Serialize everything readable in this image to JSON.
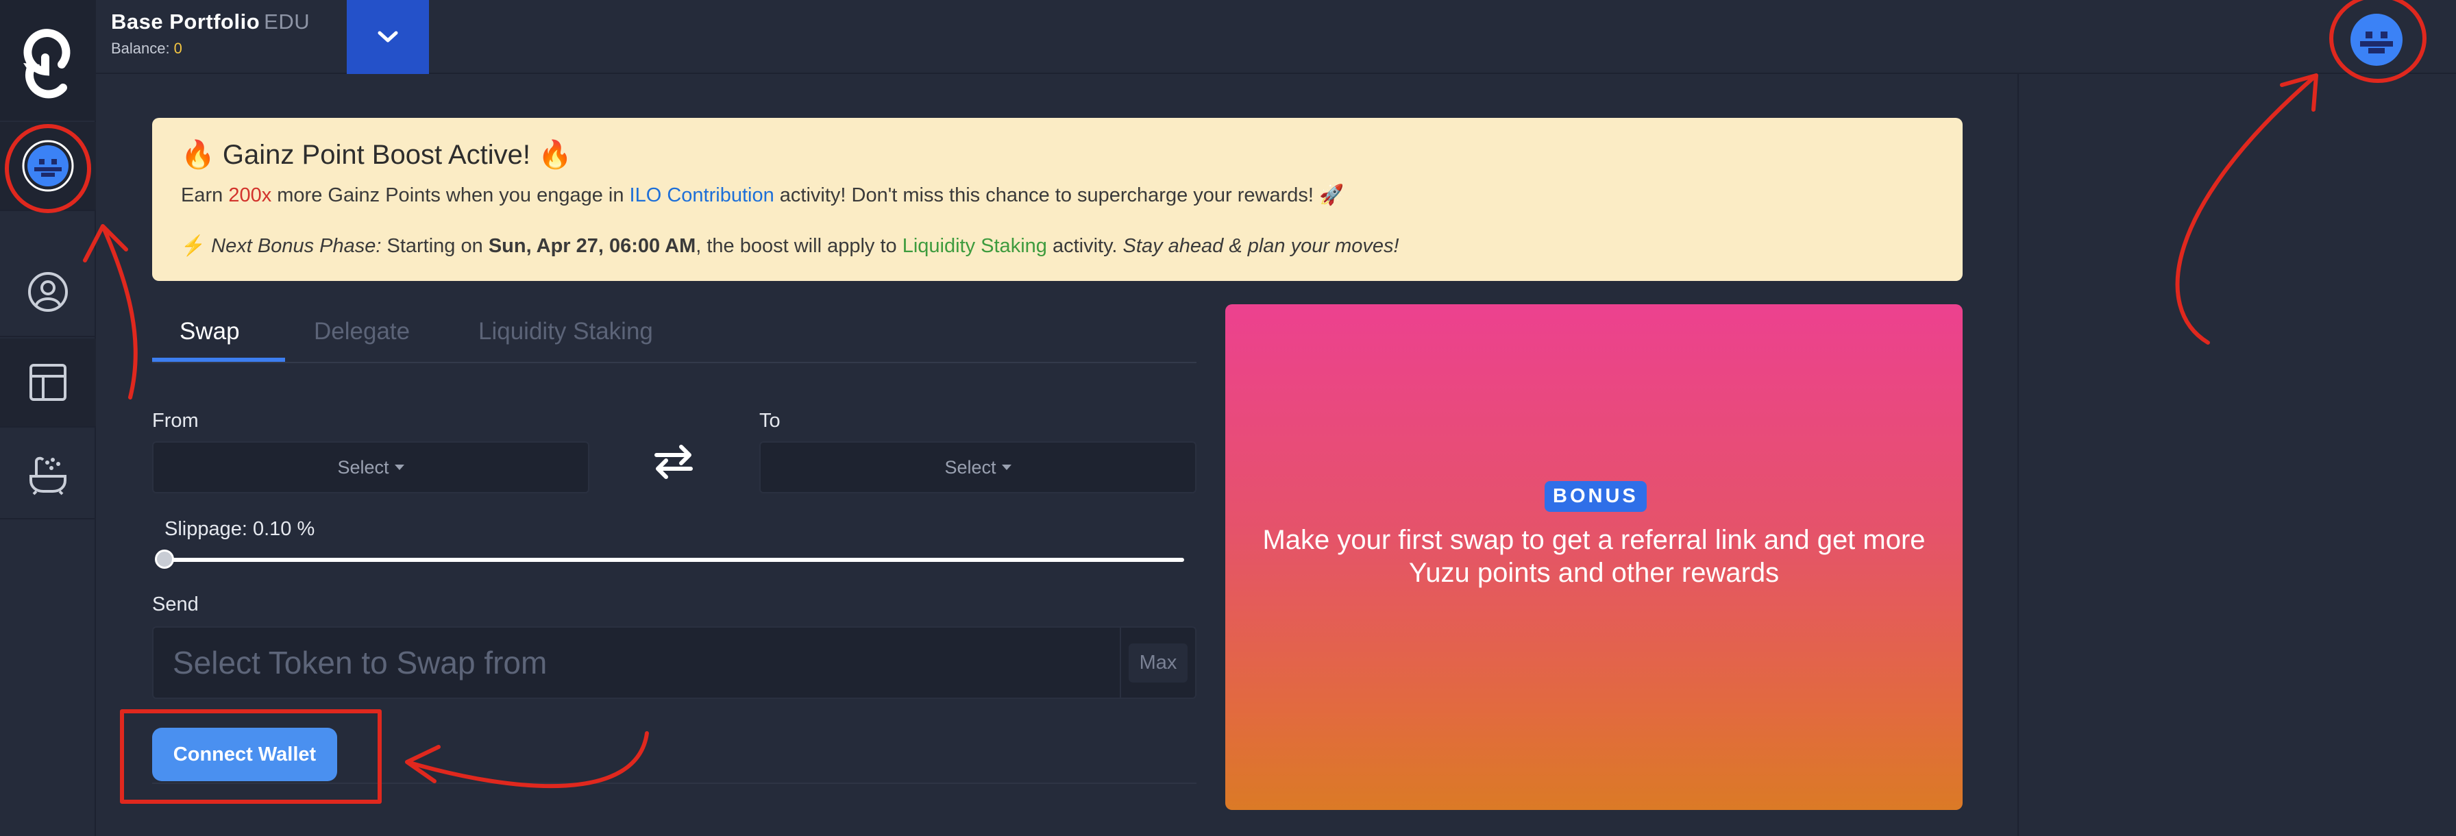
{
  "header": {
    "portfolio_name": "Base Portfolio",
    "portfolio_tag": "EDU",
    "balance_label": "Balance:",
    "balance_value": "0"
  },
  "sidebar": {
    "items": [
      {
        "icon": "user-circle-icon"
      },
      {
        "icon": "layout-icon"
      },
      {
        "icon": "bathtub-icon"
      }
    ]
  },
  "banner": {
    "title": "🔥 Gainz Point Boost Active! 🔥",
    "line1_prefix": "Earn ",
    "line1_multiplier": "200x",
    "line1_mid": " more Gainz Points when you engage in ",
    "line1_link": "ILO Contribution",
    "line1_suffix": " activity! Don't miss this chance to supercharge your rewards! 🚀",
    "line2_icon": "⚡",
    "line2_label": " Next Bonus Phase:",
    "line2_pre": " Starting on ",
    "line2_date": "Sun, Apr 27, 06:00 AM",
    "line2_mid": ", the boost will apply to ",
    "line2_link": "Liquidity Staking",
    "line2_post": " activity. ",
    "line2_tip": "Stay ahead & plan your moves!"
  },
  "tabs": [
    {
      "label": "Swap",
      "active": true
    },
    {
      "label": "Delegate",
      "active": false
    },
    {
      "label": "Liquidity Staking",
      "active": false
    }
  ],
  "swap": {
    "from_label": "From",
    "to_label": "To",
    "from_select": "Select",
    "to_select": "Select",
    "slippage_label": "Slippage: 0.10 %",
    "slippage_fraction": 0,
    "send_label": "Send",
    "send_placeholder": "Select Token to Swap from",
    "max_label": "Max",
    "connect_label": "Connect Wallet"
  },
  "bonus": {
    "badge": "BONUS",
    "text": "Make your first swap to get a referral link and get more Yuzu points and other rewards"
  },
  "colors": {
    "accent": "#2451c9",
    "button": "#4a90f0",
    "annotation": "#e0281e"
  }
}
